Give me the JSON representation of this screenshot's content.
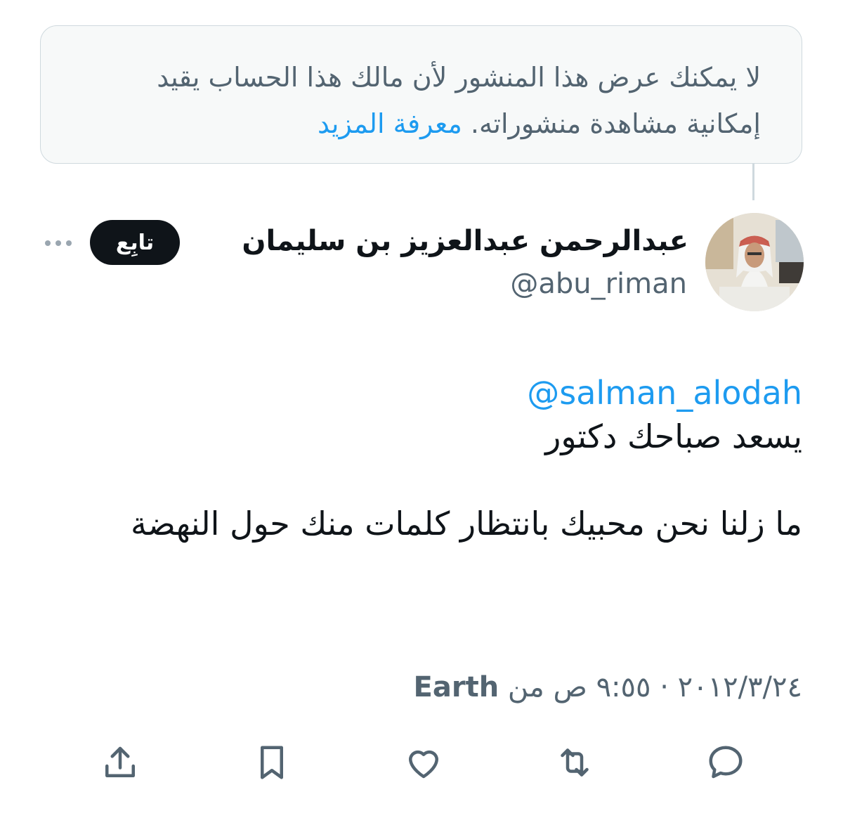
{
  "notice": {
    "text": "لا يمكنك عرض هذا المنشور لأن مالك هذا الحساب يقيد إمكانية مشاهدة منشوراته.",
    "link": "معرفة المزيد"
  },
  "author": {
    "name": "عبدالرحمن عبدالعزيز بن سليمان",
    "handle": "@abu_riman",
    "avatar_icon": "user-photo"
  },
  "follow_label": "تابِع",
  "tweet": {
    "mention": "@salman_alodah",
    "line1": "يسعد صباحك دكتور",
    "line2": "ما زلنا نحن محبيك بانتظار كلمات منك حول النهضة"
  },
  "meta": {
    "date_time": "٢٠١٢/٣/٢٤ · ٩:٥٥ ص",
    "from_label": "من",
    "source": "Earth"
  },
  "actions": [
    "reply-icon",
    "retweet-icon",
    "like-icon",
    "bookmark-icon",
    "share-icon"
  ],
  "colors": {
    "accent": "#1d9bf0",
    "text": "#0f1419",
    "muted": "#536471",
    "border": "#cfd9de",
    "notice_bg": "#f7f9f9"
  }
}
